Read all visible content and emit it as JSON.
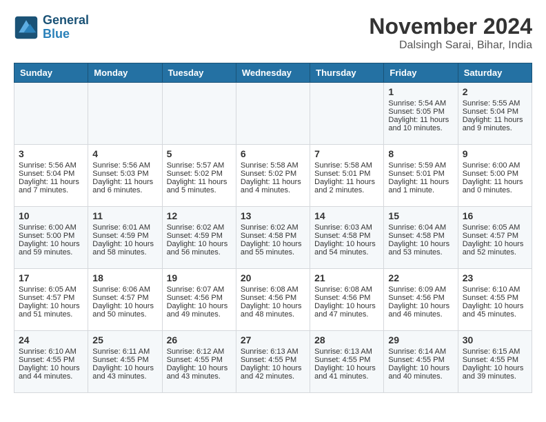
{
  "logo": {
    "text_general": "General",
    "text_blue": "Blue"
  },
  "title": {
    "month": "November 2024",
    "location": "Dalsingh Sarai, Bihar, India"
  },
  "headers": [
    "Sunday",
    "Monday",
    "Tuesday",
    "Wednesday",
    "Thursday",
    "Friday",
    "Saturday"
  ],
  "weeks": [
    [
      {
        "day": "",
        "content": ""
      },
      {
        "day": "",
        "content": ""
      },
      {
        "day": "",
        "content": ""
      },
      {
        "day": "",
        "content": ""
      },
      {
        "day": "",
        "content": ""
      },
      {
        "day": "1",
        "content": "Sunrise: 5:54 AM\nSunset: 5:05 PM\nDaylight: 11 hours and 10 minutes."
      },
      {
        "day": "2",
        "content": "Sunrise: 5:55 AM\nSunset: 5:04 PM\nDaylight: 11 hours and 9 minutes."
      }
    ],
    [
      {
        "day": "3",
        "content": "Sunrise: 5:56 AM\nSunset: 5:04 PM\nDaylight: 11 hours and 7 minutes."
      },
      {
        "day": "4",
        "content": "Sunrise: 5:56 AM\nSunset: 5:03 PM\nDaylight: 11 hours and 6 minutes."
      },
      {
        "day": "5",
        "content": "Sunrise: 5:57 AM\nSunset: 5:02 PM\nDaylight: 11 hours and 5 minutes."
      },
      {
        "day": "6",
        "content": "Sunrise: 5:58 AM\nSunset: 5:02 PM\nDaylight: 11 hours and 4 minutes."
      },
      {
        "day": "7",
        "content": "Sunrise: 5:58 AM\nSunset: 5:01 PM\nDaylight: 11 hours and 2 minutes."
      },
      {
        "day": "8",
        "content": "Sunrise: 5:59 AM\nSunset: 5:01 PM\nDaylight: 11 hours and 1 minute."
      },
      {
        "day": "9",
        "content": "Sunrise: 6:00 AM\nSunset: 5:00 PM\nDaylight: 11 hours and 0 minutes."
      }
    ],
    [
      {
        "day": "10",
        "content": "Sunrise: 6:00 AM\nSunset: 5:00 PM\nDaylight: 10 hours and 59 minutes."
      },
      {
        "day": "11",
        "content": "Sunrise: 6:01 AM\nSunset: 4:59 PM\nDaylight: 10 hours and 58 minutes."
      },
      {
        "day": "12",
        "content": "Sunrise: 6:02 AM\nSunset: 4:59 PM\nDaylight: 10 hours and 56 minutes."
      },
      {
        "day": "13",
        "content": "Sunrise: 6:02 AM\nSunset: 4:58 PM\nDaylight: 10 hours and 55 minutes."
      },
      {
        "day": "14",
        "content": "Sunrise: 6:03 AM\nSunset: 4:58 PM\nDaylight: 10 hours and 54 minutes."
      },
      {
        "day": "15",
        "content": "Sunrise: 6:04 AM\nSunset: 4:58 PM\nDaylight: 10 hours and 53 minutes."
      },
      {
        "day": "16",
        "content": "Sunrise: 6:05 AM\nSunset: 4:57 PM\nDaylight: 10 hours and 52 minutes."
      }
    ],
    [
      {
        "day": "17",
        "content": "Sunrise: 6:05 AM\nSunset: 4:57 PM\nDaylight: 10 hours and 51 minutes."
      },
      {
        "day": "18",
        "content": "Sunrise: 6:06 AM\nSunset: 4:57 PM\nDaylight: 10 hours and 50 minutes."
      },
      {
        "day": "19",
        "content": "Sunrise: 6:07 AM\nSunset: 4:56 PM\nDaylight: 10 hours and 49 minutes."
      },
      {
        "day": "20",
        "content": "Sunrise: 6:08 AM\nSunset: 4:56 PM\nDaylight: 10 hours and 48 minutes."
      },
      {
        "day": "21",
        "content": "Sunrise: 6:08 AM\nSunset: 4:56 PM\nDaylight: 10 hours and 47 minutes."
      },
      {
        "day": "22",
        "content": "Sunrise: 6:09 AM\nSunset: 4:56 PM\nDaylight: 10 hours and 46 minutes."
      },
      {
        "day": "23",
        "content": "Sunrise: 6:10 AM\nSunset: 4:55 PM\nDaylight: 10 hours and 45 minutes."
      }
    ],
    [
      {
        "day": "24",
        "content": "Sunrise: 6:10 AM\nSunset: 4:55 PM\nDaylight: 10 hours and 44 minutes."
      },
      {
        "day": "25",
        "content": "Sunrise: 6:11 AM\nSunset: 4:55 PM\nDaylight: 10 hours and 43 minutes."
      },
      {
        "day": "26",
        "content": "Sunrise: 6:12 AM\nSunset: 4:55 PM\nDaylight: 10 hours and 43 minutes."
      },
      {
        "day": "27",
        "content": "Sunrise: 6:13 AM\nSunset: 4:55 PM\nDaylight: 10 hours and 42 minutes."
      },
      {
        "day": "28",
        "content": "Sunrise: 6:13 AM\nSunset: 4:55 PM\nDaylight: 10 hours and 41 minutes."
      },
      {
        "day": "29",
        "content": "Sunrise: 6:14 AM\nSunset: 4:55 PM\nDaylight: 10 hours and 40 minutes."
      },
      {
        "day": "30",
        "content": "Sunrise: 6:15 AM\nSunset: 4:55 PM\nDaylight: 10 hours and 39 minutes."
      }
    ]
  ]
}
